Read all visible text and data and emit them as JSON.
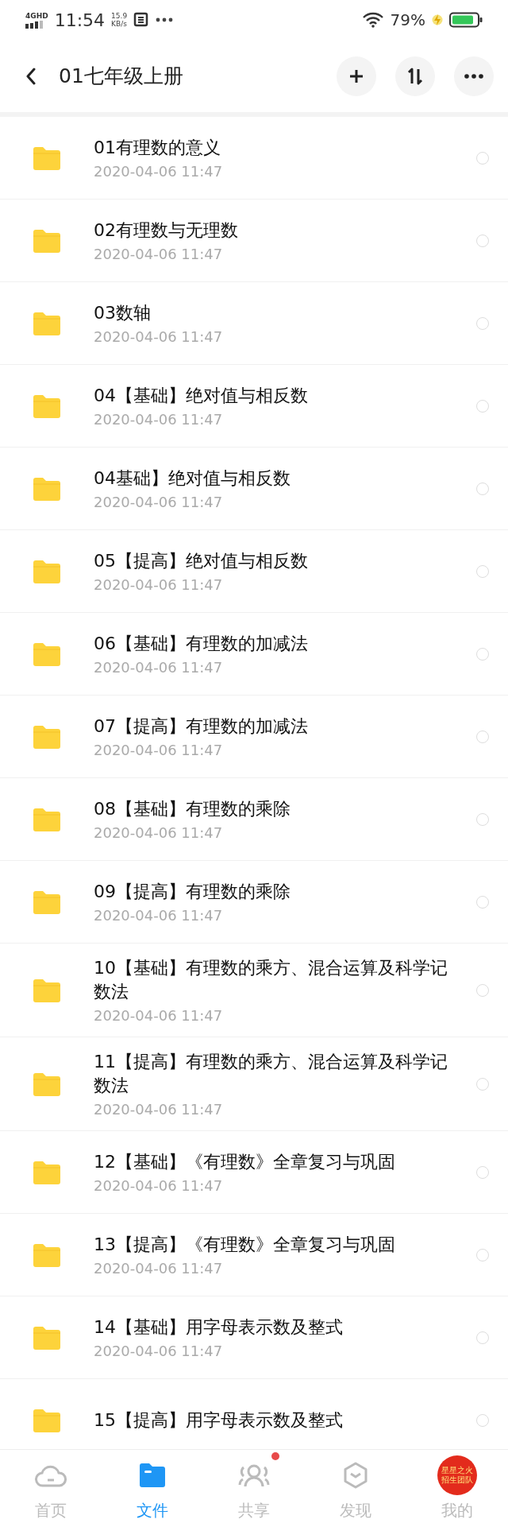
{
  "status_bar": {
    "network": "4GHD",
    "time": "11:54",
    "speed_value": "15.9",
    "speed_unit": "KB/s",
    "battery": "79%"
  },
  "header": {
    "title": "01七年级上册"
  },
  "files": [
    {
      "name": "01有理数的意义",
      "date": "2020-04-06  11:47",
      "selected": false
    },
    {
      "name": "02有理数与无理数",
      "date": "2020-04-06  11:47",
      "selected": false
    },
    {
      "name": "03数轴",
      "date": "2020-04-06  11:47",
      "selected": false
    },
    {
      "name": "04【基础】绝对值与相反数",
      "date": "2020-04-06  11:47",
      "selected": false
    },
    {
      "name": "04基础】绝对值与相反数",
      "date": "2020-04-06  11:47",
      "selected": false
    },
    {
      "name": "05【提高】绝对值与相反数",
      "date": "2020-04-06  11:47",
      "selected": false
    },
    {
      "name": "06【基础】有理数的加减法",
      "date": "2020-04-06  11:47",
      "selected": false
    },
    {
      "name": "07【提高】有理数的加减法",
      "date": "2020-04-06  11:47",
      "selected": false
    },
    {
      "name": "08【基础】有理数的乘除",
      "date": "2020-04-06  11:47",
      "selected": false
    },
    {
      "name": "09【提高】有理数的乘除",
      "date": "2020-04-06  11:47",
      "selected": false
    },
    {
      "name": "10【基础】有理数的乘方、混合运算及科学记数法",
      "date": "2020-04-06  11:47",
      "selected": false
    },
    {
      "name": "11【提高】有理数的乘方、混合运算及科学记数法",
      "date": "2020-04-06  11:47",
      "selected": false
    },
    {
      "name": "12【基础】《有理数》全章复习与巩固",
      "date": "2020-04-06  11:47",
      "selected": false
    },
    {
      "name": "13【提高】《有理数》全章复习与巩固",
      "date": "2020-04-06  11:47",
      "selected": false
    },
    {
      "name": "14【基础】用字母表示数及整式",
      "date": "2020-04-06  11:47",
      "selected": false
    },
    {
      "name": "15【提高】用字母表示数及整式",
      "selected": false
    }
  ],
  "tab_bar": [
    {
      "kind": "home",
      "label": "首页",
      "selected": false,
      "badge": false
    },
    {
      "kind": "files",
      "label": "文件",
      "selected": true,
      "badge": false
    },
    {
      "kind": "share",
      "label": "共享",
      "selected": false,
      "badge": true
    },
    {
      "kind": "discover",
      "label": "发现",
      "selected": false,
      "badge": false
    },
    {
      "kind": "avatar",
      "label": "我的",
      "selected": false,
      "badge": false,
      "avatar_lines": [
        "星星之火",
        "招生团队"
      ]
    }
  ]
}
